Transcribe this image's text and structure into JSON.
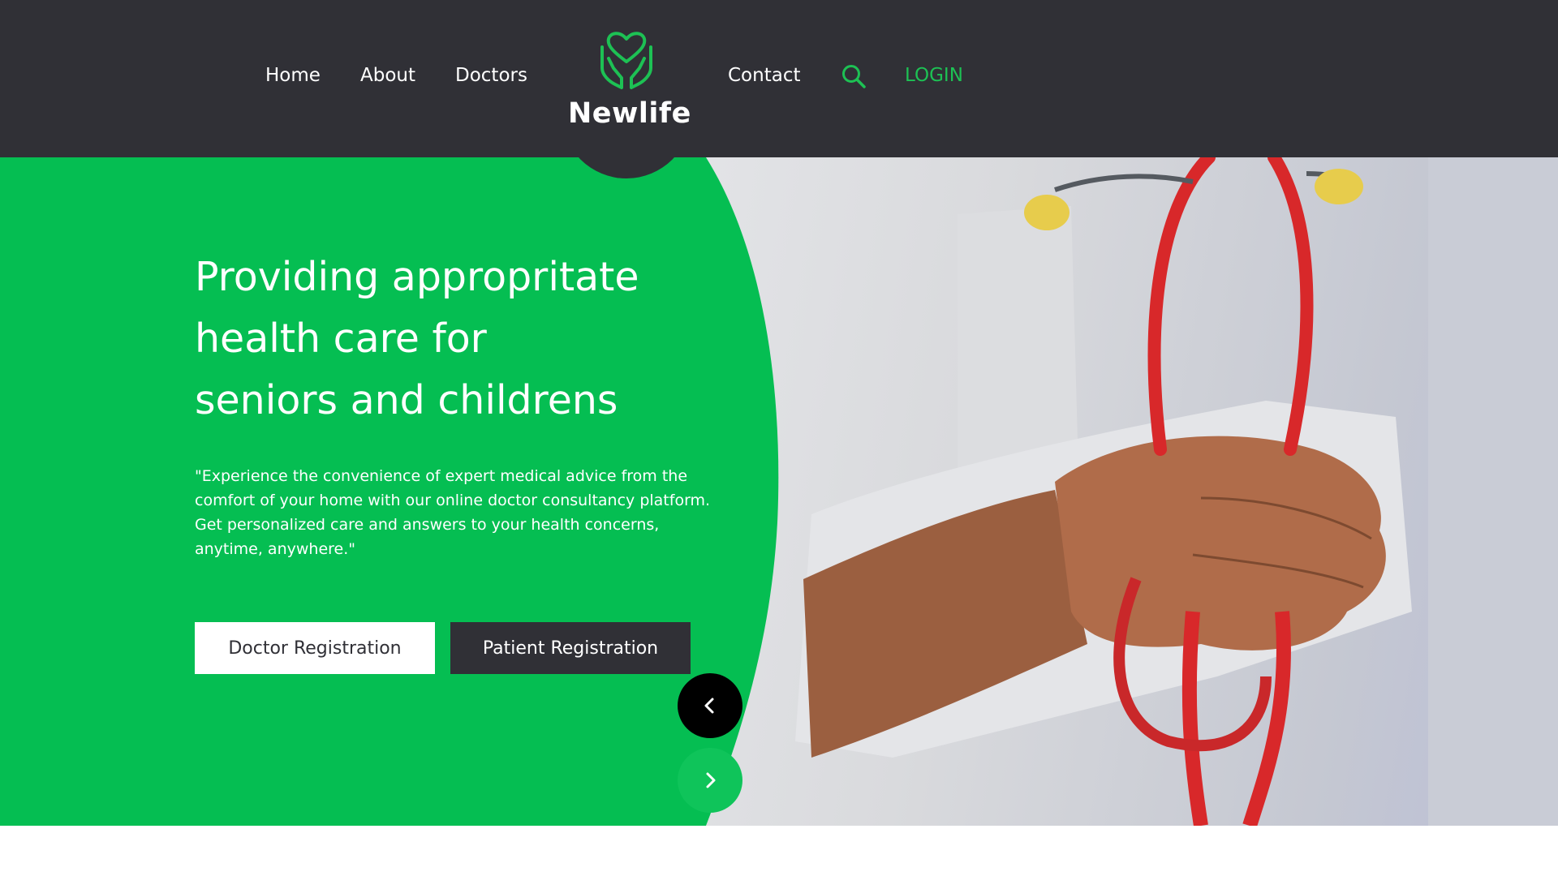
{
  "nav": {
    "home": "Home",
    "about": "About",
    "doctors": "Doctors",
    "contact": "Contact",
    "login": "LOGIN",
    "search_icon": "search-icon"
  },
  "brand": {
    "name": "Newlife",
    "logo_icon": "heart-hands-icon"
  },
  "hero": {
    "title_lines": [
      "Providing appropritate",
      "health care for",
      "seniors and childrens"
    ],
    "description": "\"Experience the convenience of expert medical advice from the comfort of your home with our online doctor consultancy platform. Get personalized care and answers to your health concerns, anytime, anywhere.\"",
    "doctor_button": "Doctor Registration",
    "patient_button": "Patient Registration",
    "prev_icon": "chevron-left-icon",
    "next_icon": "chevron-right-icon"
  },
  "colors": {
    "header_bg": "#303036",
    "accent_green": "#05be52",
    "login_green": "#1dc154",
    "next_arrow_bg": "#0fc45a"
  }
}
